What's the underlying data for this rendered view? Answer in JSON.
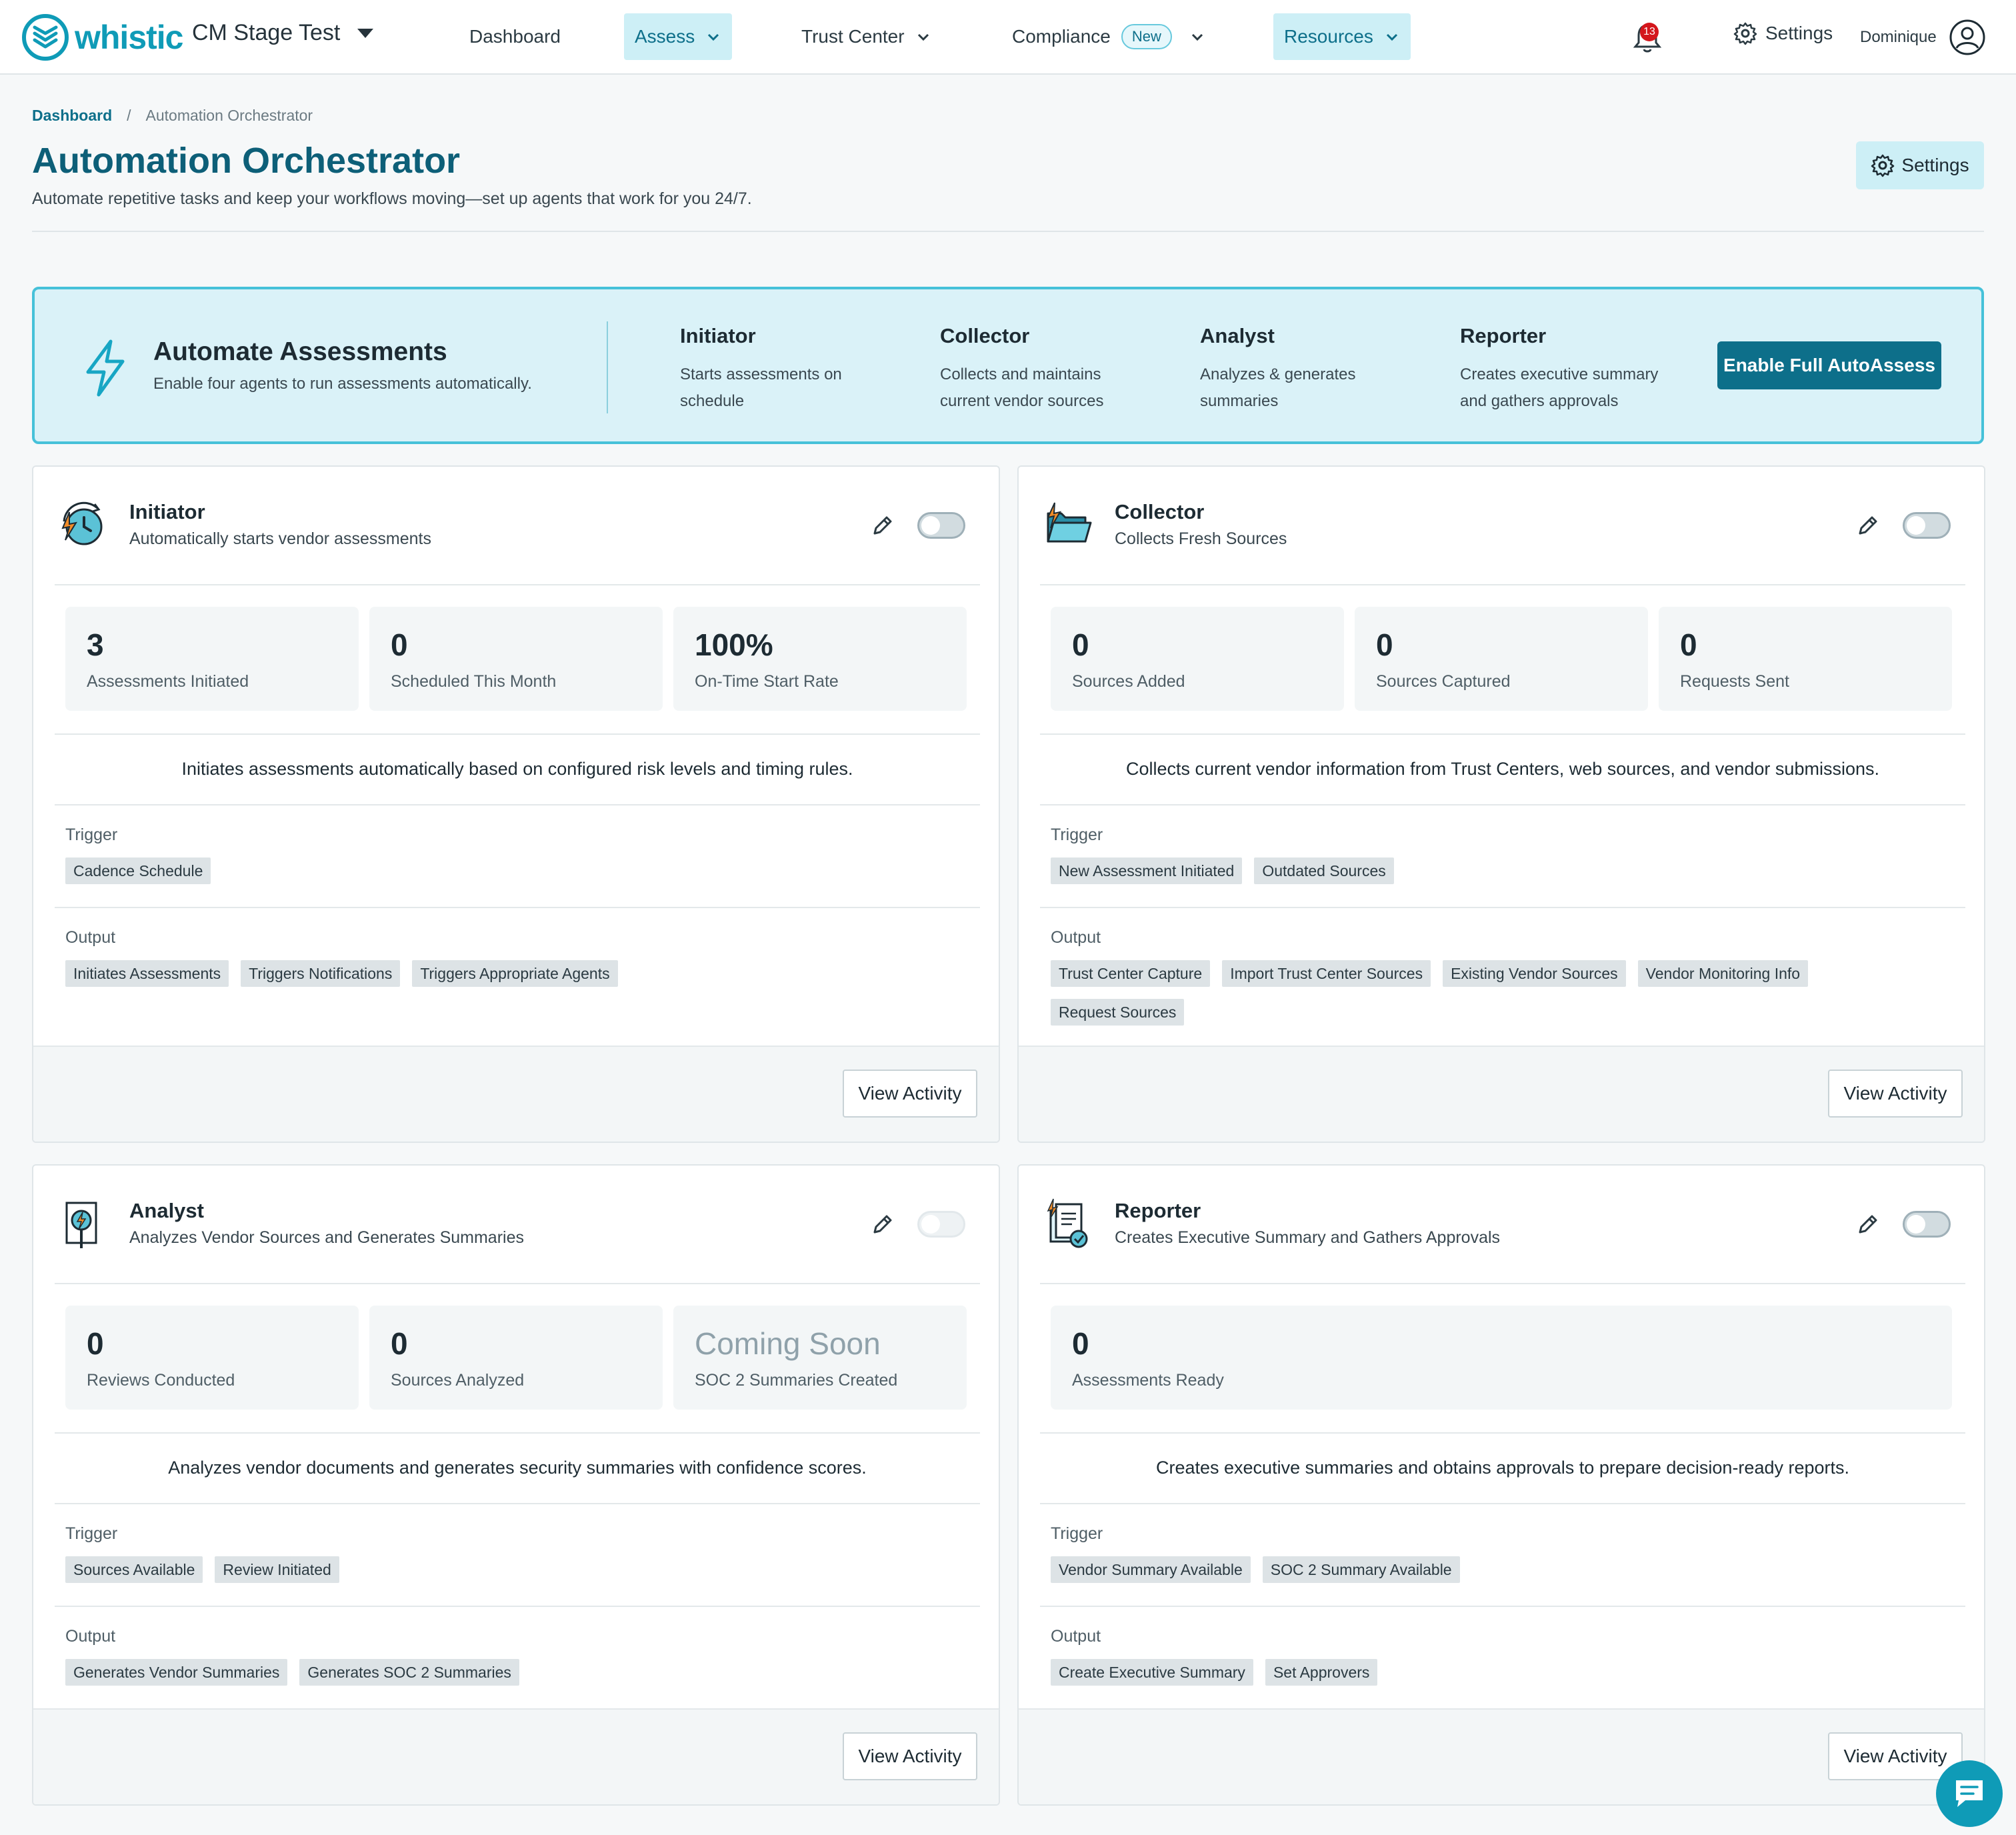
{
  "brand": {
    "name": "whistic",
    "color": "#0f9bb7"
  },
  "org": {
    "name": "CM Stage Test"
  },
  "nav": {
    "items": [
      {
        "label": "Dashboard"
      },
      {
        "label": "Assess"
      },
      {
        "label": "Trust Center"
      },
      {
        "label": "Compliance",
        "badge": "New"
      },
      {
        "label": "Resources"
      }
    ],
    "notifications": "13",
    "settings": "Settings",
    "user": "Dominique"
  },
  "breadcrumb": {
    "home": "Dashboard",
    "sep": "/",
    "current": "Automation Orchestrator"
  },
  "page": {
    "title": "Automation Orchestrator",
    "subtitle": "Automate repetitive tasks and keep your workflows moving—set up agents that work for you 24/7.",
    "settings_label": "Settings"
  },
  "banner": {
    "title": "Automate Assessments",
    "subtitle": "Enable four agents to run assessments automatically.",
    "agents": [
      {
        "name": "Initiator",
        "line1": "Starts assessments on",
        "line2": "schedule"
      },
      {
        "name": "Collector",
        "line1": "Collects and maintains",
        "line2": "current vendor sources"
      },
      {
        "name": "Analyst",
        "line1": "Analyzes & generates",
        "line2": "summaries"
      },
      {
        "name": "Reporter",
        "line1": "Creates executive summary",
        "line2": "and gathers approvals"
      }
    ],
    "cta": "Enable Full AutoAssess"
  },
  "cards": {
    "initiator": {
      "title": "Initiator",
      "subtitle": "Automatically starts vendor assessments",
      "stats": [
        {
          "value": "3",
          "label": "Assessments Initiated"
        },
        {
          "value": "0",
          "label": "Scheduled This Month"
        },
        {
          "value": "100%",
          "label": "On-Time Start Rate"
        }
      ],
      "description": "Initiates assessments automatically based on configured risk levels and timing rules.",
      "trigger_label": "Trigger",
      "triggers": [
        "Cadence Schedule"
      ],
      "output_label": "Output",
      "outputs": [
        "Initiates Assessments",
        "Triggers Notifications",
        "Triggers Appropriate Agents"
      ],
      "action": "View Activity"
    },
    "collector": {
      "title": "Collector",
      "subtitle": "Collects Fresh Sources",
      "stats": [
        {
          "value": "0",
          "label": "Sources Added"
        },
        {
          "value": "0",
          "label": "Sources Captured"
        },
        {
          "value": "0",
          "label": "Requests Sent"
        }
      ],
      "description": "Collects current vendor information from Trust Centers, web sources, and vendor submissions.",
      "trigger_label": "Trigger",
      "triggers": [
        "New Assessment Initiated",
        "Outdated Sources"
      ],
      "output_label": "Output",
      "outputs": [
        "Trust Center Capture",
        "Import Trust Center Sources",
        "Existing Vendor Sources",
        "Vendor Monitoring Info",
        "Request Sources"
      ],
      "action": "View Activity"
    },
    "analyst": {
      "title": "Analyst",
      "subtitle": "Analyzes Vendor Sources and Generates Summaries",
      "stats": [
        {
          "value": "0",
          "label": "Reviews Conducted"
        },
        {
          "value": "0",
          "label": "Sources Analyzed"
        },
        {
          "value": "Coming Soon",
          "label": "SOC 2 Summaries Created"
        }
      ],
      "description": "Analyzes vendor documents and generates security summaries with confidence scores.",
      "trigger_label": "Trigger",
      "triggers": [
        "Sources Available",
        "Review Initiated"
      ],
      "output_label": "Output",
      "outputs": [
        "Generates Vendor Summaries",
        "Generates SOC 2 Summaries"
      ],
      "action": "View Activity"
    },
    "reporter": {
      "title": "Reporter",
      "subtitle": "Creates Executive Summary and Gathers Approvals",
      "stats": [
        {
          "value": "0",
          "label": "Assessments Ready"
        }
      ],
      "description": "Creates executive summaries and obtains approvals to prepare decision-ready reports.",
      "trigger_label": "Trigger",
      "triggers": [
        "Vendor Summary Available",
        "SOC 2 Summary Available"
      ],
      "output_label": "Output",
      "outputs": [
        "Create Executive Summary",
        "Set Approvers"
      ],
      "action": "View Activity"
    }
  },
  "colors": {
    "accent": "#0d6f8a",
    "banner_bg": "#daf2f8",
    "banner_border": "#46c1d9",
    "notification": "#d4161c"
  }
}
